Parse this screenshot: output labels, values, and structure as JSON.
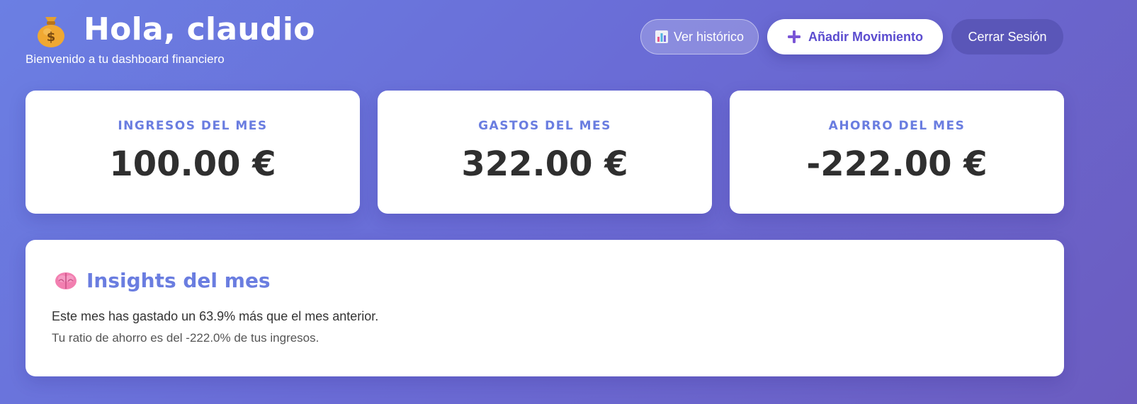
{
  "header": {
    "title": "Hola, claudio",
    "subtitle": "Bienvenido a tu dashboard financiero",
    "title_icon": "money-bag-icon"
  },
  "actions": {
    "history_label": "Ver histórico",
    "history_icon": "bar-chart-icon",
    "add_label": "Añadir Movimiento",
    "add_icon": "plus-icon",
    "logout_label": "Cerrar Sesión"
  },
  "summary": {
    "income": {
      "label": "INGRESOS DEL MES",
      "value": "100.00 €"
    },
    "expenses": {
      "label": "GASTOS DEL MES",
      "value": "322.00 €"
    },
    "savings": {
      "label": "AHORRO DEL MES",
      "value": "-222.00 €"
    }
  },
  "insights": {
    "icon": "brain-icon",
    "title": "Insights del mes",
    "messages": [
      "Este mes has gastado un 63.9% más que el mes anterior.",
      "Tu ratio de ahorro es del -222.0% de tus ingresos."
    ]
  },
  "colors": {
    "accent": "#6a7de0",
    "button_text": "#5b4ccf",
    "background_start": "#6b7fe3",
    "background_end": "#6b5cc0"
  }
}
